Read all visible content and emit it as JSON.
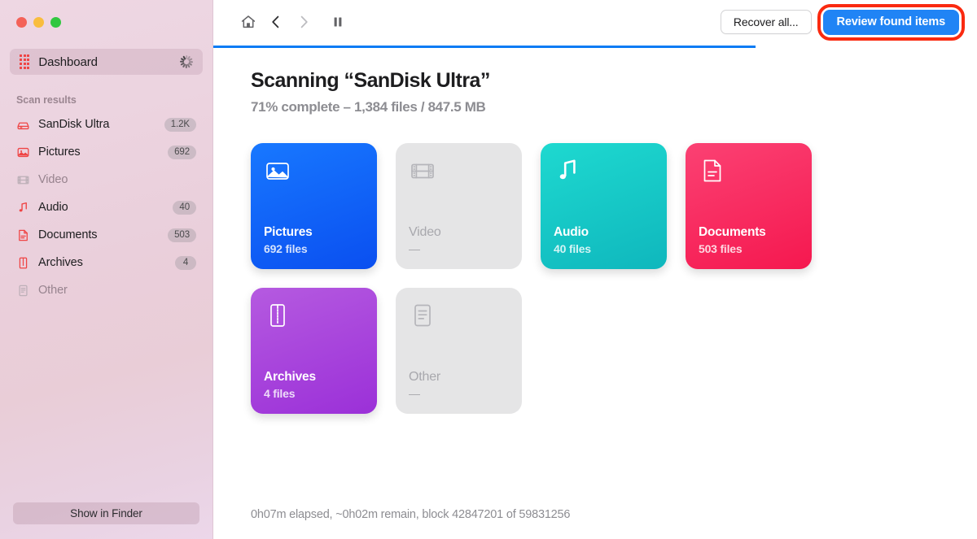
{
  "window": {
    "traffic_lights": [
      "close",
      "minimize",
      "zoom"
    ]
  },
  "sidebar": {
    "dashboard": {
      "label": "Dashboard",
      "icon": "grid-icon",
      "busy_icon": "spinner-icon"
    },
    "section_title": "Scan results",
    "items": [
      {
        "label": "SanDisk Ultra",
        "badge": "1.2K",
        "icon": "drive-icon",
        "enabled": true
      },
      {
        "label": "Pictures",
        "badge": "692",
        "icon": "picture-icon",
        "enabled": true
      },
      {
        "label": "Video",
        "badge": "",
        "icon": "film-icon",
        "enabled": false
      },
      {
        "label": "Audio",
        "badge": "40",
        "icon": "music-note-icon",
        "enabled": true
      },
      {
        "label": "Documents",
        "badge": "503",
        "icon": "document-icon",
        "enabled": true
      },
      {
        "label": "Archives",
        "badge": "4",
        "icon": "archive-zip-icon",
        "enabled": true
      },
      {
        "label": "Other",
        "badge": "",
        "icon": "file-lines-icon",
        "enabled": false
      }
    ],
    "footer_button": "Show in Finder"
  },
  "toolbar": {
    "home_icon": "home-icon",
    "back_icon": "chevron-left-icon",
    "forward_icon": "chevron-right-icon",
    "pause_icon": "pause-icon",
    "recover_all_label": "Recover all...",
    "review_label": "Review found items",
    "highlight_color": "#fa2a10",
    "primary_color": "#2084f5"
  },
  "progress": {
    "percent": 71,
    "bar_color": "#0a7cf5"
  },
  "main": {
    "heading": "Scanning “SanDisk Ultra”",
    "subheading": "71% complete – 1,384 files / 847.5 MB",
    "status": "0h07m elapsed, ~0h02m remain, block 42847201 of 59831256"
  },
  "cards": [
    {
      "title": "Pictures",
      "count": "692 files",
      "icon": "picture-icon",
      "enabled": true,
      "color_from": "#1878ff",
      "color_to": "#0a4ff0"
    },
    {
      "title": "Video",
      "count": "—",
      "icon": "film-icon",
      "enabled": false,
      "color_from": "#e5e5e6",
      "color_to": "#e5e5e6"
    },
    {
      "title": "Audio",
      "count": "40 files",
      "icon": "music-note-icon",
      "enabled": true,
      "color_from": "#1ed9d0",
      "color_to": "#0fb7bd"
    },
    {
      "title": "Documents",
      "count": "503 files",
      "icon": "document-icon",
      "enabled": true,
      "color_from": "#fb4173",
      "color_to": "#f5184f"
    },
    {
      "title": "Archives",
      "count": "4 files",
      "icon": "archive-zip-icon",
      "enabled": true,
      "color_from": "#b55ae0",
      "color_to": "#9b30d8"
    },
    {
      "title": "Other",
      "count": "—",
      "icon": "file-lines-icon",
      "enabled": false,
      "color_from": "#e5e5e6",
      "color_to": "#e5e5e6"
    }
  ]
}
